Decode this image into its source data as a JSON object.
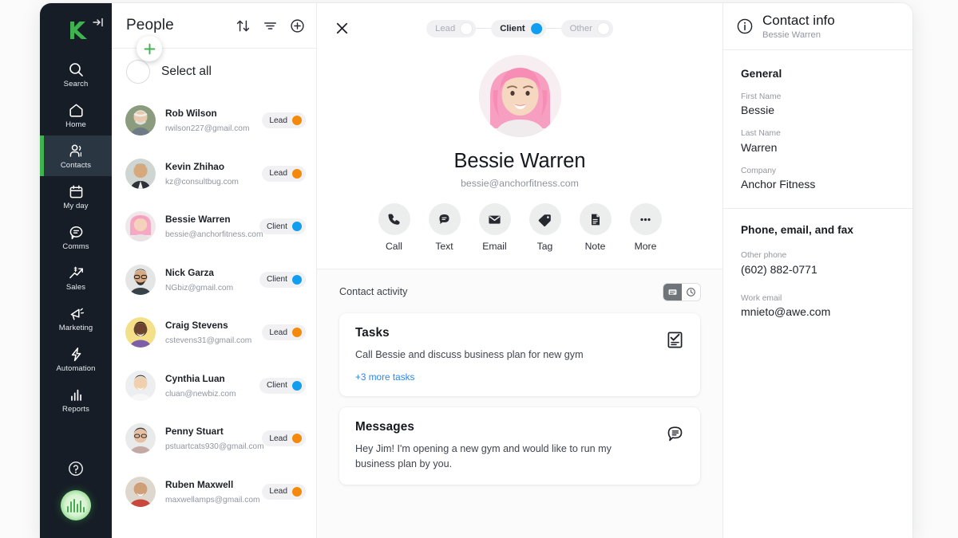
{
  "brand": {
    "accent_green": "#3fb34f",
    "accent_blue": "#119ef0",
    "accent_orange": "#f5890b",
    "rail_bg": "#161d26"
  },
  "rail": {
    "logo_name": "keap-logo",
    "expand_label": "expand-sidebar",
    "items": [
      {
        "label": "Search",
        "icon": "search-icon",
        "active": false
      },
      {
        "label": "Home",
        "icon": "home-icon",
        "active": false
      },
      {
        "label": "Contacts",
        "icon": "contacts-icon",
        "active": true
      },
      {
        "label": "My day",
        "icon": "calendar-icon",
        "active": false
      },
      {
        "label": "Comms",
        "icon": "chat-icon",
        "active": false
      },
      {
        "label": "Sales",
        "icon": "sales-trend-icon",
        "active": false
      },
      {
        "label": "Marketing",
        "icon": "megaphone-icon",
        "active": false
      },
      {
        "label": "Automation",
        "icon": "lightning-icon",
        "active": false
      },
      {
        "label": "Reports",
        "icon": "bar-chart-icon",
        "active": false
      }
    ],
    "help_label": "help-icon",
    "user_orb_label": "user-avatar-orb",
    "fab_label": "add-new-button"
  },
  "list": {
    "title": "People",
    "sort_label": "sort-icon",
    "filter_label": "filter-icon",
    "add_label": "add-contact-icon",
    "select_all_label": "Select all",
    "contacts": [
      {
        "name": "Rob Wilson",
        "email": "rwilson227@gmail.com",
        "status": "Lead",
        "status_color": "#f5890b"
      },
      {
        "name": "Kevin Zhihao",
        "email": "kz@consultbug.com",
        "status": "Lead",
        "status_color": "#f5890b"
      },
      {
        "name": "Bessie Warren",
        "email": "bessie@anchorfitness.com",
        "status": "Client",
        "status_color": "#119ef0"
      },
      {
        "name": "Nick Garza",
        "email": "NGbiz@gmail.com",
        "status": "Client",
        "status_color": "#119ef0"
      },
      {
        "name": "Craig Stevens",
        "email": "cstevens31@gmail.com",
        "status": "Lead",
        "status_color": "#f5890b"
      },
      {
        "name": "Cynthia Luan",
        "email": "cluan@newbiz.com",
        "status": "Client",
        "status_color": "#119ef0"
      },
      {
        "name": "Penny Stuart",
        "email": "pstuartcats930@gmail.com",
        "status": "Lead",
        "status_color": "#f5890b"
      },
      {
        "name": "Ruben Maxwell",
        "email": "maxwellamps@gmail.com",
        "status": "Lead",
        "status_color": "#f5890b"
      }
    ]
  },
  "detail": {
    "close_label": "close-icon",
    "segments": [
      {
        "label": "Lead",
        "active": false
      },
      {
        "label": "Client",
        "active": true
      },
      {
        "label": "Other",
        "active": false
      }
    ],
    "avatar_label": "contact-avatar",
    "name": "Bessie Warren",
    "email": "bessie@anchorfitness.com",
    "actions": [
      {
        "label": "Call",
        "icon": "phone-icon"
      },
      {
        "label": "Text",
        "icon": "chat-bubble-icon"
      },
      {
        "label": "Email",
        "icon": "envelope-icon"
      },
      {
        "label": "Tag",
        "icon": "tag-icon"
      },
      {
        "label": "Note",
        "icon": "document-icon"
      },
      {
        "label": "More",
        "icon": "ellipsis-icon"
      }
    ],
    "activity_title": "Contact activity",
    "view_toggle": [
      {
        "icon": "card-view-icon",
        "active": true
      },
      {
        "icon": "clock-timeline-icon",
        "active": false
      }
    ],
    "cards": [
      {
        "title": "Tasks",
        "body": "Call Bessie and discuss business plan for new gym",
        "link": "+3 more tasks",
        "icon": "checklist-icon"
      },
      {
        "title": "Messages",
        "body": "Hey Jim! I'm opening a new gym and would like to run my business plan by you.",
        "link": "",
        "icon": "message-lines-icon"
      }
    ]
  },
  "info": {
    "icon": "info-circle-icon",
    "title": "Contact info",
    "subtitle": "Bessie Warren",
    "general_title": "General",
    "general_fields": [
      {
        "label": "First Name",
        "value": "Bessie"
      },
      {
        "label": "Last Name",
        "value": "Warren"
      },
      {
        "label": "Company",
        "value": "Anchor Fitness"
      }
    ],
    "contact_title": "Phone, email, and fax",
    "contact_fields": [
      {
        "label": "Other phone",
        "value": "(602) 882-0771"
      },
      {
        "label": "Work email",
        "value": "mnieto@awe.com"
      }
    ]
  }
}
